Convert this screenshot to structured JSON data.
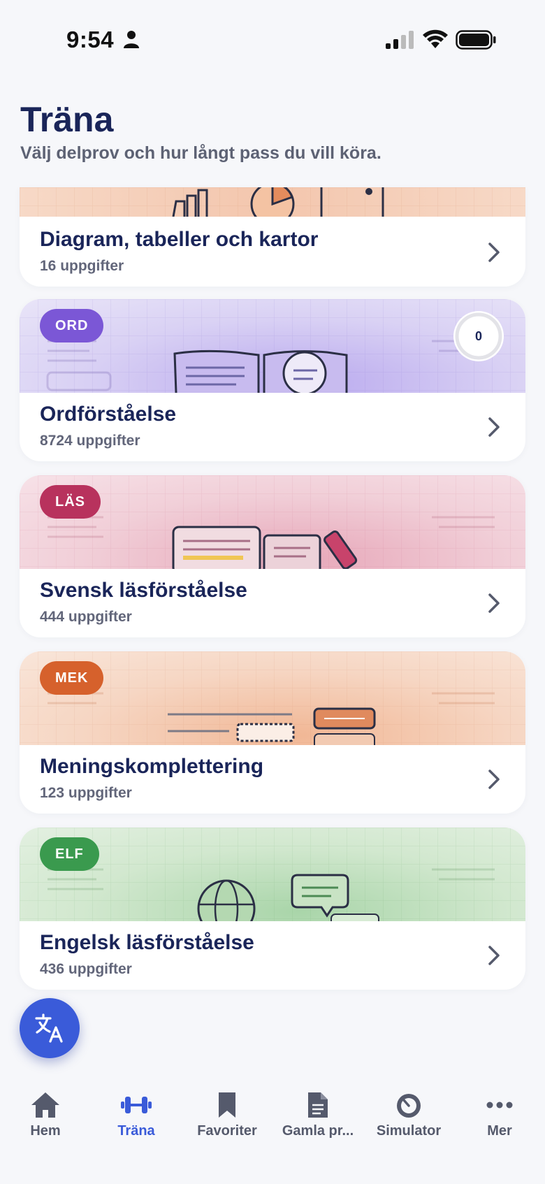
{
  "status_bar": {
    "time": "9:54"
  },
  "header": {
    "title": "Träna",
    "subtitle": "Välj delprov och hur långt pass du vill köra."
  },
  "cards": [
    {
      "badge": "",
      "title": "Diagram, tabeller och kartor",
      "count": "16 uppgifter",
      "theme": "#f4ccb3"
    },
    {
      "badge": "ORD",
      "title": "Ordförståelse",
      "count": "8724 uppgifter",
      "badge_color": "#7b57d6",
      "theme": "#d3c8f1",
      "progress": "0"
    },
    {
      "badge": "LÄS",
      "title": "Svensk läsförståelse",
      "count": "444 uppgifter",
      "badge_color": "#b8325d",
      "theme": "#f0c6d1"
    },
    {
      "badge": "MEK",
      "title": "Meningskomplettering",
      "count": "123 uppgifter",
      "badge_color": "#d6612c",
      "theme": "#f5d2bd"
    },
    {
      "badge": "ELF",
      "title": "Engelsk läsförståelse",
      "count": "436 uppgifter",
      "badge_color": "#3a9a4e",
      "theme": "#cfe6cd"
    }
  ],
  "fab": {
    "icon": "translate-icon"
  },
  "tabbar": {
    "tabs": [
      {
        "label": "Hem",
        "icon": "home-icon"
      },
      {
        "label": "Träna",
        "icon": "dumbbell-icon",
        "active": true
      },
      {
        "label": "Favoriter",
        "icon": "bookmark-icon"
      },
      {
        "label": "Gamla pr...",
        "icon": "document-icon"
      },
      {
        "label": "Simulator",
        "icon": "timer-icon"
      },
      {
        "label": "Mer",
        "icon": "more-icon"
      }
    ],
    "active_color": "#3a5bd9"
  }
}
